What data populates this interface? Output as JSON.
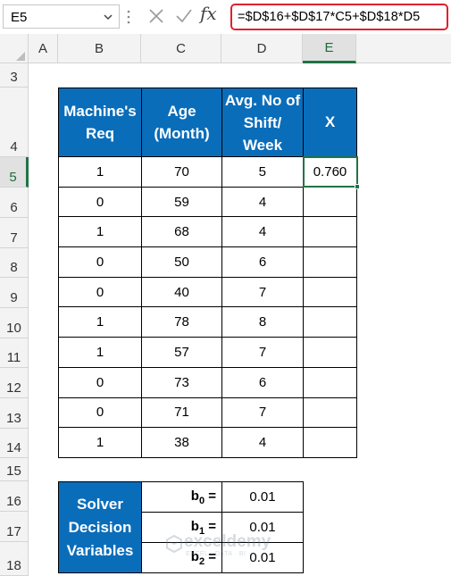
{
  "formula_bar": {
    "name_box": "E5",
    "fx_label": "fx",
    "formula": "=$D$16+$D$17*C5+$D$18*D5"
  },
  "columns": [
    "A",
    "B",
    "C",
    "D",
    "E"
  ],
  "selected_column": "E",
  "rows": [
    "3",
    "4",
    "5",
    "6",
    "7",
    "8",
    "9",
    "10",
    "11",
    "12",
    "13",
    "14",
    "15",
    "16",
    "17",
    "18"
  ],
  "selected_row": "5",
  "table": {
    "headers": [
      "Machine's Req",
      "Age (Month)",
      "Avg. No of Shift/ Week",
      "X"
    ],
    "rows": [
      [
        "1",
        "70",
        "5",
        "0.760"
      ],
      [
        "0",
        "59",
        "4",
        ""
      ],
      [
        "1",
        "68",
        "4",
        ""
      ],
      [
        "0",
        "50",
        "6",
        ""
      ],
      [
        "0",
        "40",
        "7",
        ""
      ],
      [
        "1",
        "78",
        "8",
        ""
      ],
      [
        "1",
        "57",
        "7",
        ""
      ],
      [
        "0",
        "73",
        "6",
        ""
      ],
      [
        "0",
        "71",
        "7",
        ""
      ],
      [
        "1",
        "38",
        "4",
        ""
      ]
    ]
  },
  "solver": {
    "label": "Solver Decision Variables",
    "vars": [
      {
        "sym": "b",
        "sub": "0",
        "eq": " =",
        "value": "0.01"
      },
      {
        "sym": "b",
        "sub": "1",
        "eq": " =",
        "value": "0.01"
      },
      {
        "sym": "b",
        "sub": "2",
        "eq": " =",
        "value": "0.01"
      }
    ]
  },
  "watermark": {
    "name": "exceldemy",
    "tagline": "EXCEL · DATA · BI"
  },
  "colors": {
    "header_blue": "#0a6dba",
    "selection_green": "#217346",
    "formula_highlight": "#e0202d"
  }
}
